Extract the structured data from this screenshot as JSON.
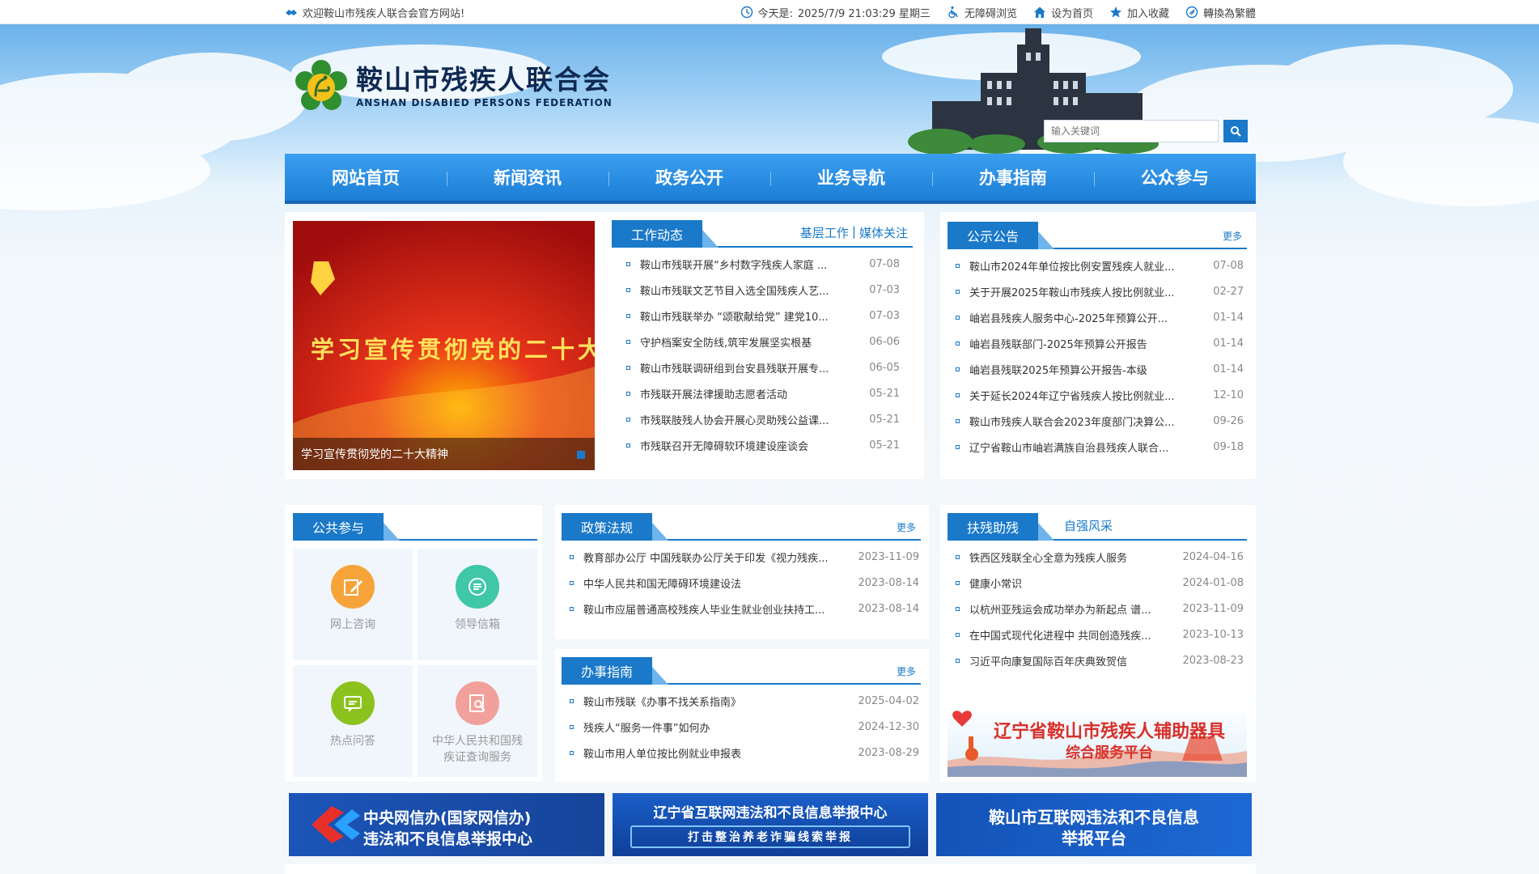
{
  "topbar": {
    "welcome": "欢迎鞍山市残疾人联合会官方网站!",
    "today_label": "今天是:",
    "datetime": "2025/7/9 21:03:29 星期三",
    "accessibility": "无障碍浏览",
    "set_home": "设为首页",
    "favorite": "加入收藏",
    "traditional": "轉換為繁體"
  },
  "header": {
    "title_cn": "鞍山市残疾人联合会",
    "title_en": "ANSHAN DISABIED PERSONS FEDERATION",
    "search_placeholder": "输入关键词"
  },
  "nav": [
    "网站首页",
    "新闻资讯",
    "政务公开",
    "业务导航",
    "办事指南",
    "公众参与"
  ],
  "slide": {
    "banner_text": "学习宣传贯彻党的二十大精神",
    "caption": "学习宣传贯彻党的二十大精神"
  },
  "work": {
    "tab": "工作动态",
    "sub1": "基层工作",
    "sep": "|",
    "sub2": "媒体关注",
    "items": [
      {
        "title": "鞍山市残联开展“乡村数字残疾人家庭 ...",
        "date": "07-08"
      },
      {
        "title": "鞍山市残联文艺节目入选全国残疾人艺...",
        "date": "07-03"
      },
      {
        "title": "鞍山市残联举办 “颂歌献给党” 建党10...",
        "date": "07-03"
      },
      {
        "title": "守护档案安全防线,筑牢发展坚实根基",
        "date": "06-06"
      },
      {
        "title": "鞍山市残联调研组到台安县残联开展专...",
        "date": "06-05"
      },
      {
        "title": "市残联开展法律援助志愿者活动",
        "date": "05-21"
      },
      {
        "title": "市残联肢残人协会开展心灵助残公益课...",
        "date": "05-21"
      },
      {
        "title": "市残联召开无障碍软环境建设座谈会",
        "date": "05-21"
      }
    ]
  },
  "notice": {
    "tab": "公示公告",
    "more": "更多",
    "items": [
      {
        "title": "鞍山市2024年单位按比例安置残疾人就业...",
        "date": "07-08"
      },
      {
        "title": "关于开展2025年鞍山市残疾人按比例就业...",
        "date": "02-27"
      },
      {
        "title": "岫岩县残疾人服务中心-2025年预算公开...",
        "date": "01-14"
      },
      {
        "title": "岫岩县残联部门-2025年预算公开报告",
        "date": "01-14"
      },
      {
        "title": "岫岩县残联2025年预算公开报告-本级",
        "date": "01-14"
      },
      {
        "title": "关于延长2024年辽宁省残疾人按比例就业...",
        "date": "12-10"
      },
      {
        "title": "鞍山市残疾人联合会2023年度部门决算公...",
        "date": "09-26"
      },
      {
        "title": "辽宁省鞍山市岫岩满族自治县残疾人联合...",
        "date": "09-18"
      }
    ]
  },
  "public": {
    "tab": "公共参与",
    "tiles": [
      "网上咨询",
      "领导信箱",
      "热点问答",
      "中华人民共和国残疾证查询服务"
    ],
    "tile4_line1": "中华人民共和国残",
    "tile4_line2": "疾证查询服务"
  },
  "policy": {
    "tab": "政策法规",
    "more": "更多",
    "items": [
      {
        "title": "教育部办公厅 中国残联办公厅关于印发《视力残疾...",
        "date": "2023-11-09"
      },
      {
        "title": "中华人民共和国无障碍环境建设法",
        "date": "2023-08-14"
      },
      {
        "title": "鞍山市应届普通高校残疾人毕业生就业创业扶持工...",
        "date": "2023-08-14"
      }
    ]
  },
  "guide": {
    "tab": "办事指南",
    "more": "更多",
    "items": [
      {
        "title": "鞍山市残联《办事不找关系指南》",
        "date": "2025-04-02"
      },
      {
        "title": "残疾人“服务一件事”如何办",
        "date": "2024-12-30"
      },
      {
        "title": "鞍山市用人单位按比例就业申报表",
        "date": "2023-08-29"
      }
    ]
  },
  "help": {
    "tab": "扶残助残",
    "sub": "自强风采",
    "items": [
      {
        "title": "铁西区残联全心全意为残疾人服务",
        "date": "2024-04-16"
      },
      {
        "title": "健康小常识",
        "date": "2024-01-08"
      },
      {
        "title": "以杭州亚残运会成功举办为新起点 谱...",
        "date": "2023-11-09"
      },
      {
        "title": "在中国式现代化进程中 共同创造残疾...",
        "date": "2023-10-13"
      },
      {
        "title": "习近平向康复国际百年庆典致贺信",
        "date": "2023-08-23"
      }
    ]
  },
  "promo": {
    "line1": "辽宁省鞍山市残疾人辅助器具",
    "line2": "综合服务平台"
  },
  "banners": [
    {
      "line1": "中央网信办(国家网信办)",
      "line2": "违法和不良信息举报中心"
    },
    {
      "line1": "辽宁省互联网违法和不良信息举报中心",
      "line2": "打击整治养老诈骗线索举报"
    },
    {
      "line1": "鞍山市互联网违法和不良信息",
      "line2": "举报平台"
    }
  ],
  "colors": {
    "primary": "#1a79c9",
    "nav_top": "#3a9ef0",
    "nav_bottom": "#1c7fd6"
  }
}
